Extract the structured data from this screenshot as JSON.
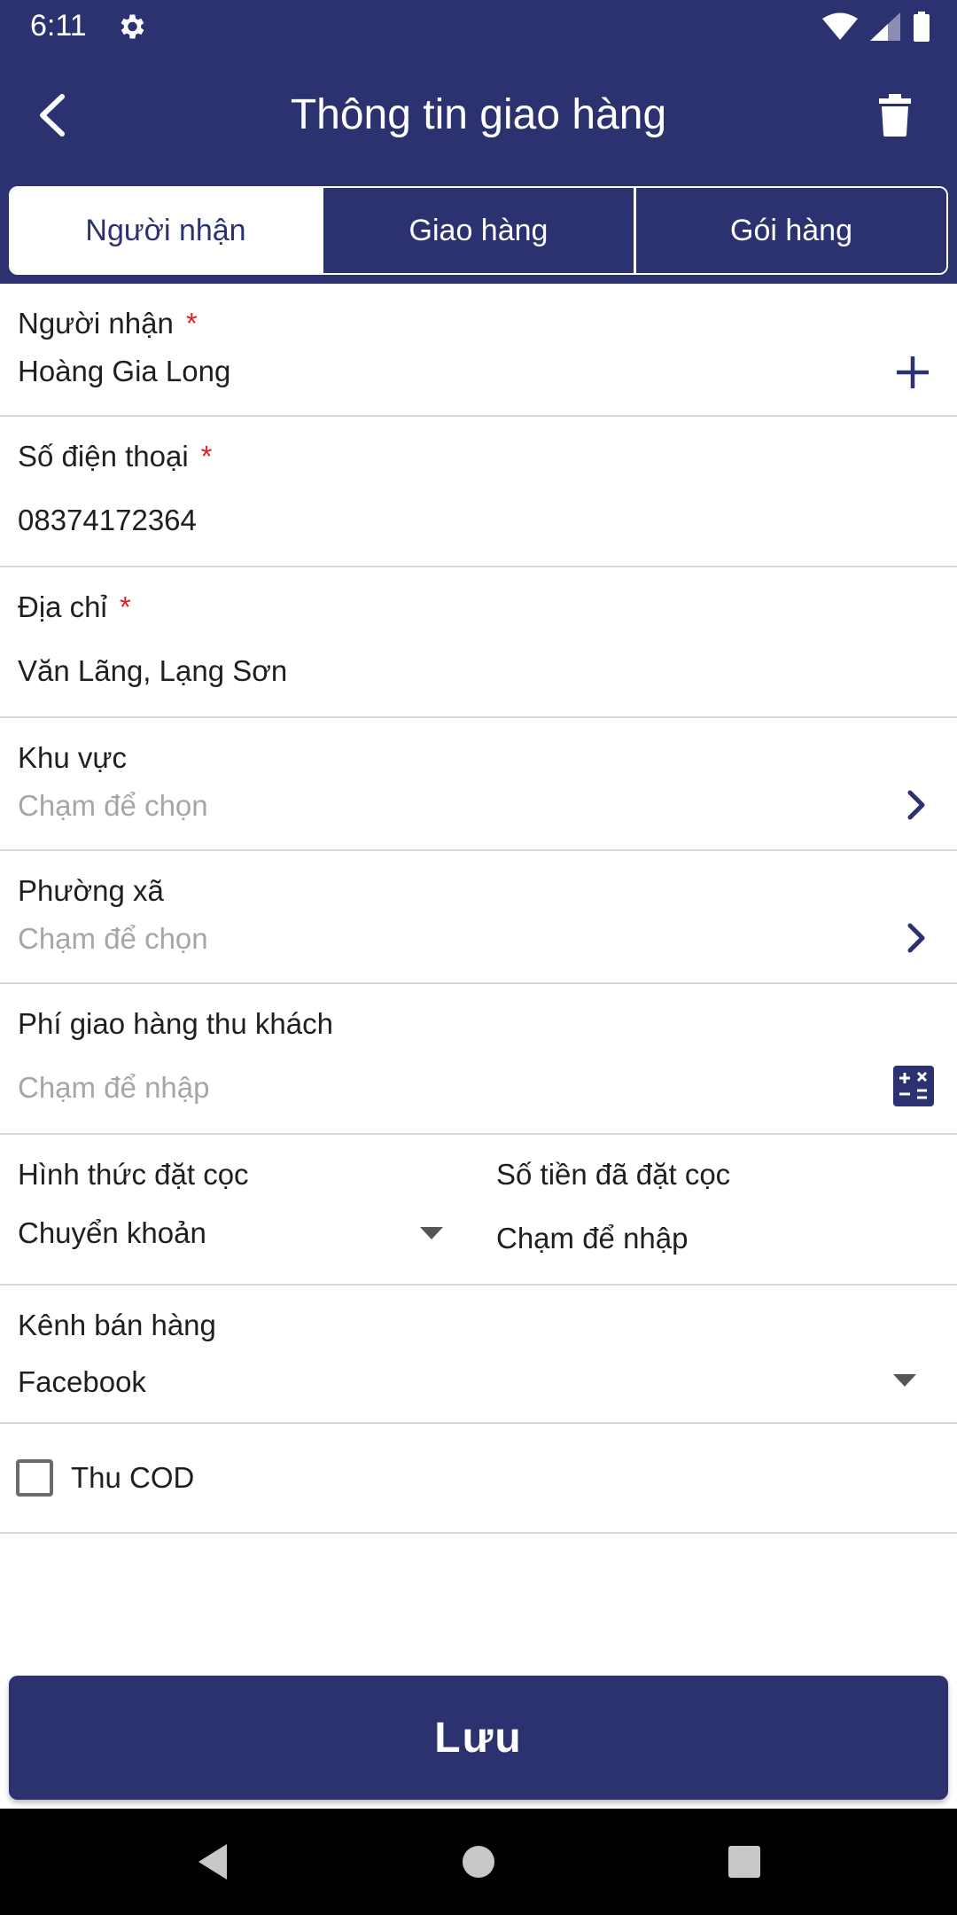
{
  "status_bar": {
    "time": "6:11"
  },
  "header": {
    "title": "Thông tin giao hàng"
  },
  "tabs": [
    {
      "label": "Người nhận",
      "active": true
    },
    {
      "label": "Giao hàng",
      "active": false
    },
    {
      "label": "Gói hàng",
      "active": false
    }
  ],
  "form": {
    "recipient": {
      "label": "Người nhận",
      "required_mark": "*",
      "value": "Hoàng Gia Long"
    },
    "phone": {
      "label": "Số điện thoại",
      "required_mark": "*",
      "value": "08374172364"
    },
    "address": {
      "label": "Địa chỉ",
      "required_mark": "*",
      "value": "Văn Lãng, Lạng Sơn"
    },
    "area": {
      "label": "Khu vực",
      "placeholder": "Chạm để chọn"
    },
    "ward": {
      "label": "Phường xã",
      "placeholder": "Chạm để chọn"
    },
    "shipping_fee": {
      "label": "Phí giao hàng thu khách",
      "placeholder": "Chạm để nhập"
    },
    "deposit_method": {
      "label": "Hình thức đặt cọc",
      "value": "Chuyển khoản"
    },
    "deposit_amount": {
      "label": "Số tiền đã đặt cọc",
      "placeholder": "Chạm để nhập"
    },
    "sales_channel": {
      "label": "Kênh bán hàng",
      "value": "Facebook"
    },
    "cod": {
      "label": "Thu COD",
      "checked": false
    }
  },
  "actions": {
    "save_label": "Lưu"
  },
  "colors": {
    "primary": "#2c3170",
    "required": "#e02020",
    "placeholder": "#a6a6a6",
    "divider": "#d9d9d9"
  },
  "icons": {
    "back": "chevron-left-icon",
    "delete": "trash-icon",
    "add": "plus-icon",
    "select": "chevron-right-icon",
    "calculator": "calculator-icon",
    "dropdown": "caret-down-icon"
  }
}
